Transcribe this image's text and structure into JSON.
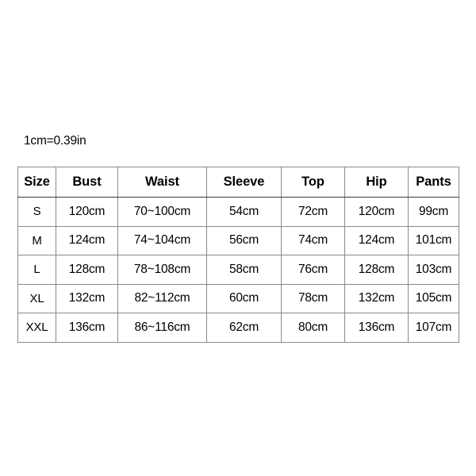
{
  "note": {
    "conversion": "1cm=0.39in"
  },
  "chart_data": {
    "type": "table",
    "title": "",
    "columns": [
      "Size",
      "Bust",
      "Waist",
      "Sleeve",
      "Top",
      "Hip",
      "Pants"
    ],
    "rows": [
      [
        "S",
        "120cm",
        "70~100cm",
        "54cm",
        "72cm",
        "120cm",
        "99cm"
      ],
      [
        "M",
        "124cm",
        "74~104cm",
        "56cm",
        "74cm",
        "124cm",
        "101cm"
      ],
      [
        "L",
        "128cm",
        "78~108cm",
        "58cm",
        "76cm",
        "128cm",
        "103cm"
      ],
      [
        "XL",
        "132cm",
        "82~112cm",
        "60cm",
        "78cm",
        "132cm",
        "105cm"
      ],
      [
        "XXL",
        "136cm",
        "86~116cm",
        "62cm",
        "80cm",
        "136cm",
        "107cm"
      ]
    ],
    "annotations": [
      "1cm=0.39in"
    ],
    "colors": {
      "background": "#ffffff",
      "text": "#000000",
      "border_outer": "#3a3a3a",
      "border_inner": "#8a8a8a"
    }
  }
}
